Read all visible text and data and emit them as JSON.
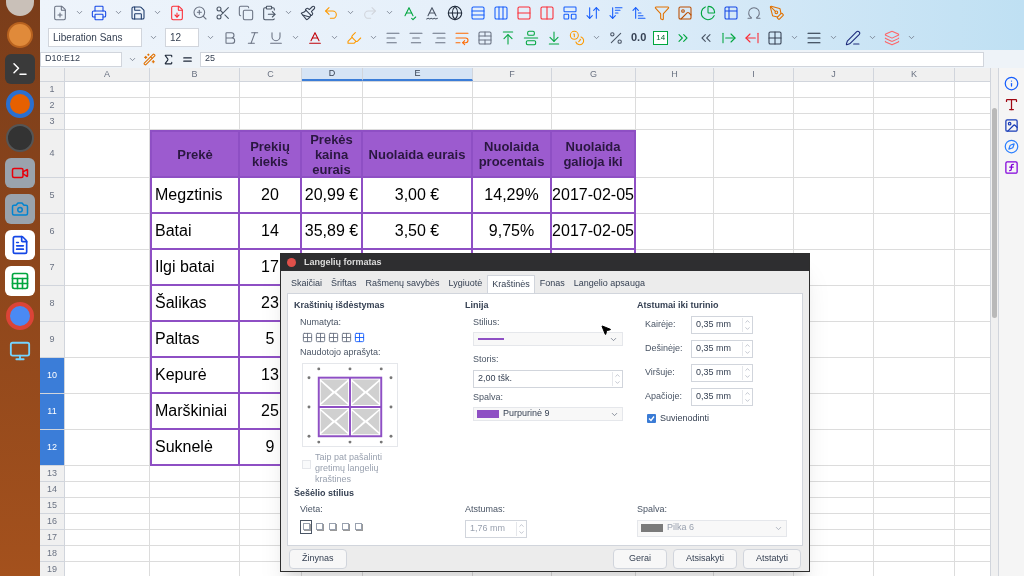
{
  "toolbar": {
    "font_name": "Liberation Sans",
    "font_size": "12",
    "number_format": "0.0",
    "date_day": "14"
  },
  "formula_bar": {
    "name_box": "D10:E12",
    "content": "25"
  },
  "sheet": {
    "columns": [
      {
        "label": "A",
        "selected": false
      },
      {
        "label": "B",
        "selected": false
      },
      {
        "label": "C",
        "selected": false
      },
      {
        "label": "D",
        "selected": true
      },
      {
        "label": "E",
        "selected": true
      },
      {
        "label": "F",
        "selected": false
      },
      {
        "label": "G",
        "selected": false
      },
      {
        "label": "H",
        "selected": false
      },
      {
        "label": "I",
        "selected": false
      },
      {
        "label": "J",
        "selected": false
      },
      {
        "label": "K",
        "selected": false
      }
    ],
    "rows": [
      {
        "label": "1",
        "selected": false
      },
      {
        "label": "2",
        "selected": false
      },
      {
        "label": "3",
        "selected": false
      },
      {
        "label": "4",
        "selected": false
      },
      {
        "label": "5",
        "selected": false
      },
      {
        "label": "6",
        "selected": false
      },
      {
        "label": "7",
        "selected": false
      },
      {
        "label": "8",
        "selected": false
      },
      {
        "label": "9",
        "selected": false
      },
      {
        "label": "10",
        "selected": true
      },
      {
        "label": "11",
        "selected": true
      },
      {
        "label": "12",
        "selected": true
      },
      {
        "label": "13",
        "selected": false
      },
      {
        "label": "14",
        "selected": false
      },
      {
        "label": "15",
        "selected": false
      },
      {
        "label": "16",
        "selected": false
      },
      {
        "label": "17",
        "selected": false
      },
      {
        "label": "18",
        "selected": false
      },
      {
        "label": "19",
        "selected": false
      }
    ]
  },
  "table": {
    "columns": [
      "Prekė",
      "Prekių kiekis",
      "Prekės kaina eurais",
      "Nuolaida eurais",
      "Nuolaida procentais",
      "Nuolaida galioja iki"
    ],
    "rows": [
      [
        "Megztinis",
        "20",
        "20,99 €",
        "3,00 €",
        "14,29%",
        "2017-02-05"
      ],
      [
        "Batai",
        "14",
        "35,89 €",
        "3,50 €",
        "9,75%",
        "2017-02-05"
      ],
      [
        "Ilgi batai",
        "17"
      ],
      [
        "Šalikas",
        "23"
      ],
      [
        "Paltas",
        "5"
      ],
      [
        "Kepurė",
        "13"
      ],
      [
        "Marškiniai",
        "25"
      ],
      [
        "Suknelė",
        "9"
      ]
    ]
  },
  "dialog": {
    "title": "Langelių formatas",
    "tabs": [
      {
        "label": "Skaičiai",
        "selected": false
      },
      {
        "label": "Šriftas",
        "selected": false
      },
      {
        "label": "Rašmenų savybės",
        "selected": false
      },
      {
        "label": "Lygiuotė",
        "selected": false
      },
      {
        "label": "Kraštinės",
        "selected": true
      },
      {
        "label": "Fonas",
        "selected": false
      },
      {
        "label": "Langelio apsauga",
        "selected": false
      }
    ],
    "arrangement": {
      "heading": "Kraštinių išdėstymas",
      "default_label": "Numatyta:",
      "custom_label": "Naudotojo aprašyta:",
      "remove_adjacent": {
        "label": "Taip pat pašalinti gretimų langelių kraštines",
        "checked": false,
        "disabled": true
      }
    },
    "line": {
      "heading": "Linija",
      "style_label": "Stilius:",
      "width_label": "Storis:",
      "width_value": "2,00 tšk.",
      "color_label": "Spalva:",
      "color_value": "Purpurinė 9"
    },
    "padding": {
      "heading": "Atstumai iki turinio",
      "fields": [
        {
          "label": "Kairėje:",
          "value": "0,35 mm"
        },
        {
          "label": "Dešinėje:",
          "value": "0,35 mm"
        },
        {
          "label": "Viršuje:",
          "value": "0,35 mm"
        },
        {
          "label": "Apačioje:",
          "value": "0,35 mm"
        }
      ],
      "sync": {
        "label": "Suvienodinti",
        "checked": true
      }
    },
    "shadow": {
      "heading": "Šešėlio stilius",
      "position_label": "Vieta:",
      "positions": [
        {
          "selected": true
        },
        {
          "selected": false
        },
        {
          "selected": false
        },
        {
          "selected": false
        },
        {
          "selected": false
        }
      ],
      "distance_label": "Atstumas:",
      "distance_value": "1,76 mm",
      "distance_disabled": true,
      "color_label": "Spalva:",
      "color_value": "Pilka 6",
      "color_disabled": true
    },
    "buttons": {
      "help": "Žinynas",
      "ok": "Gerai",
      "cancel": "Atsisakyti",
      "reset": "Atstatyti"
    }
  }
}
